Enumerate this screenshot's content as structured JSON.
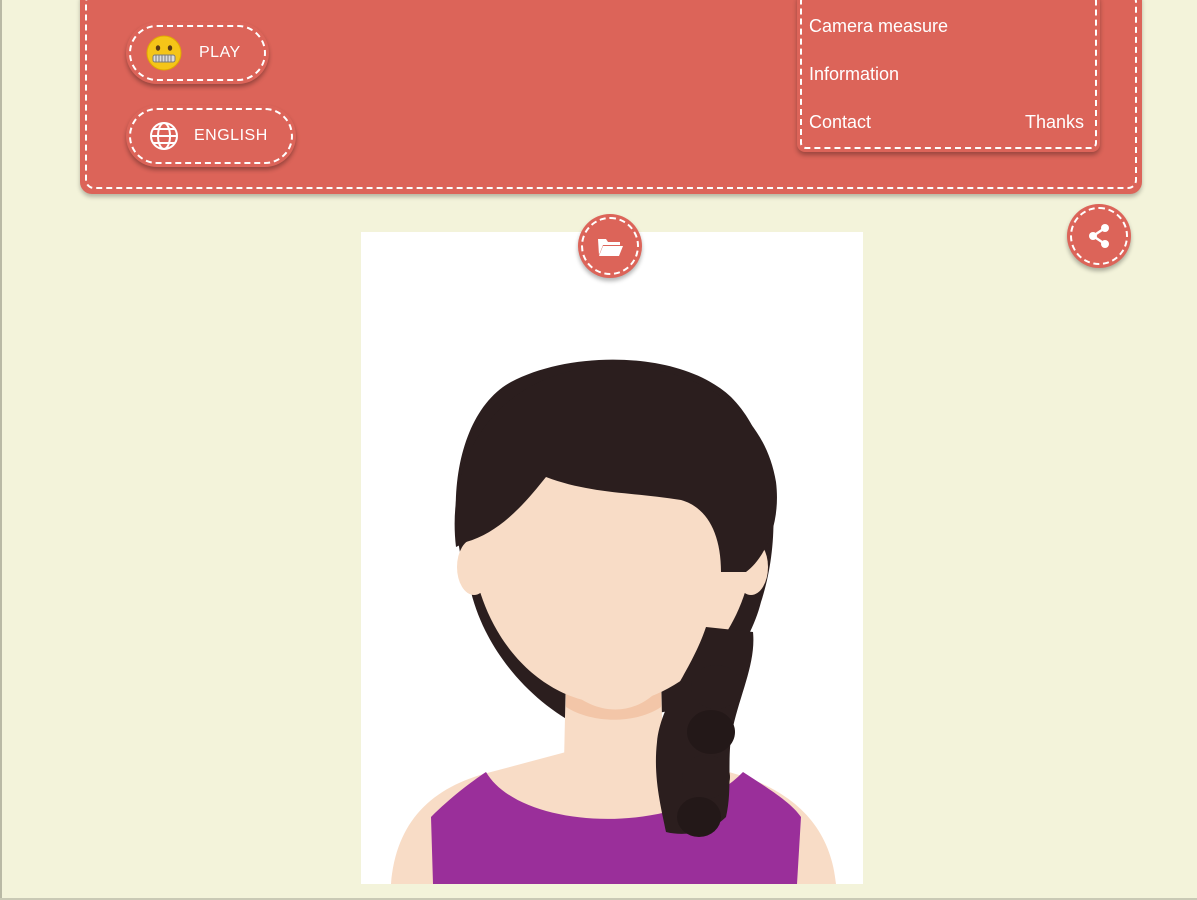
{
  "header": {
    "play_button": {
      "label": "PLAY",
      "icon": "zipper-mouth-face-icon"
    },
    "language_button": {
      "label": "ENGLISH",
      "icon": "globe-icon"
    },
    "menu": {
      "camera_measure": "Camera measure",
      "information": "Information",
      "contact": "Contact",
      "thanks": "Thanks"
    }
  },
  "actions": {
    "open_folder_icon": "open-folder-icon",
    "share_icon": "share-icon"
  },
  "photo": {
    "subject": "avatar-woman-braid"
  },
  "colors": {
    "background": "#f3f3da",
    "accent": "#dc6459",
    "hair": "#2b1e1e",
    "skin": "#f8dcc6",
    "shirt": "#9a2f9a"
  }
}
